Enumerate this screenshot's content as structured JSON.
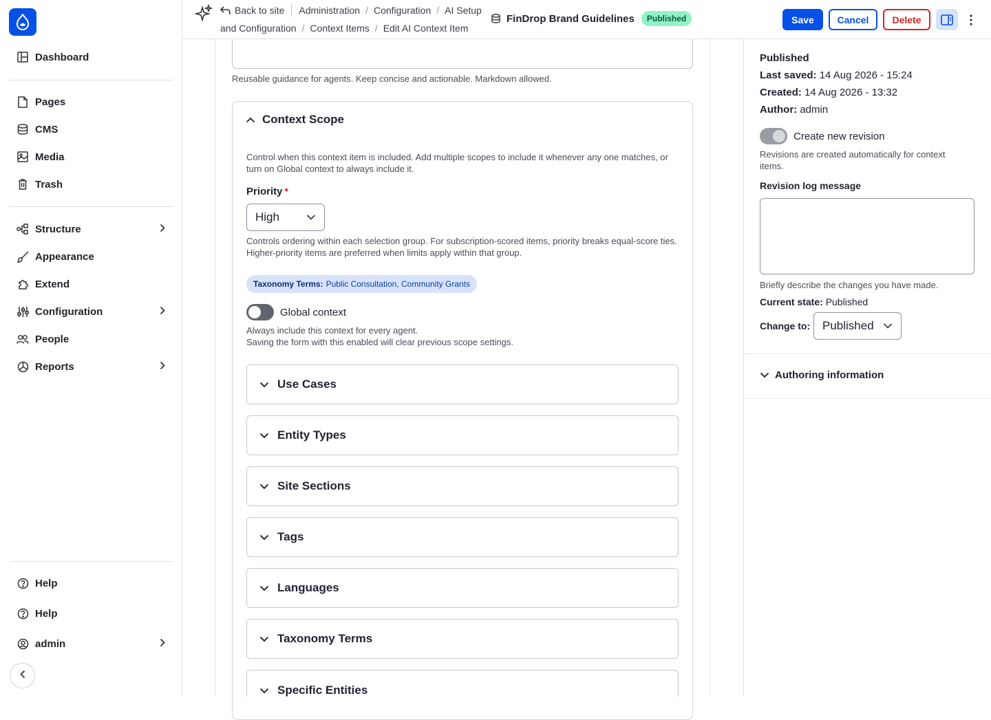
{
  "sidebar": {
    "items": [
      {
        "label": "Dashboard",
        "icon": "dashboard-icon"
      },
      {
        "label": "Pages",
        "icon": "page-icon"
      },
      {
        "label": "CMS",
        "icon": "database-icon"
      },
      {
        "label": "Media",
        "icon": "image-icon"
      },
      {
        "label": "Trash",
        "icon": "trash-icon"
      },
      {
        "label": "Structure",
        "icon": "structure-icon"
      },
      {
        "label": "Appearance",
        "icon": "brush-icon"
      },
      {
        "label": "Extend",
        "icon": "puzzle-icon"
      },
      {
        "label": "Configuration",
        "icon": "sliders-icon"
      },
      {
        "label": "People",
        "icon": "people-icon"
      },
      {
        "label": "Reports",
        "icon": "chart-icon"
      }
    ],
    "footer": [
      {
        "label": "Help",
        "icon": "help-icon"
      },
      {
        "label": "Help",
        "icon": "help-icon"
      },
      {
        "label": "admin",
        "icon": "user-icon"
      }
    ]
  },
  "topbar": {
    "back_label": "Back to site",
    "breadcrumbs_line1": [
      "Administration",
      "Configuration",
      "AI Setup"
    ],
    "breadcrumbs_line2": [
      "and Configuration",
      "Context Items",
      "Edit AI Context Item"
    ],
    "doc_title": "FinDrop Brand Guidelines",
    "status_badge": "Published",
    "save_label": "Save",
    "cancel_label": "Cancel",
    "delete_label": "Delete"
  },
  "main": {
    "body_help": "Reusable guidance for agents. Keep concise and actionable. Markdown allowed.",
    "scope": {
      "title": "Context Scope",
      "description": "Control when this context item is included. Add multiple scopes to include it whenever any one matches, or turn on Global context to always include it.",
      "priority_label": "Priority",
      "priority_value": "High",
      "priority_help": "Controls ordering within each selection group. For subscription-scored items, priority breaks equal-score ties. Higher-priority items are preferred when limits apply within that group.",
      "chip_key": "Taxonomy Terms:",
      "chip_value": "Public Consultation, Community Grants",
      "global_label": "Global context",
      "global_enabled": false,
      "global_help_1": "Always include this context for every agent.",
      "global_help_2": "Saving the form with this enabled will clear previous scope settings.",
      "accordions": [
        "Use Cases",
        "Entity Types",
        "Site Sections",
        "Tags",
        "Languages",
        "Taxonomy Terms",
        "Specific Entities"
      ]
    }
  },
  "panel": {
    "status": "Published",
    "last_saved_label": "Last saved:",
    "last_saved_value": "14 Aug 2026 - 15:24",
    "created_label": "Created:",
    "created_value": "14 Aug 2026 - 13:32",
    "author_label": "Author:",
    "author_value": "admin",
    "revision_label": "Create new revision",
    "revision_enabled": true,
    "revision_help": "Revisions are created automatically for context items.",
    "log_label": "Revision log message",
    "log_value": "",
    "log_help": "Briefly describe the changes you have made.",
    "current_state_label": "Current state:",
    "current_state_value": "Published",
    "change_to_label": "Change to:",
    "change_to_value": "Published",
    "authoring_label": "Authoring information"
  },
  "colors": {
    "primary": "#0550e6",
    "danger": "#d72222",
    "published_badge_bg": "#91f2c7",
    "chip_bg": "#d7e3fb"
  }
}
